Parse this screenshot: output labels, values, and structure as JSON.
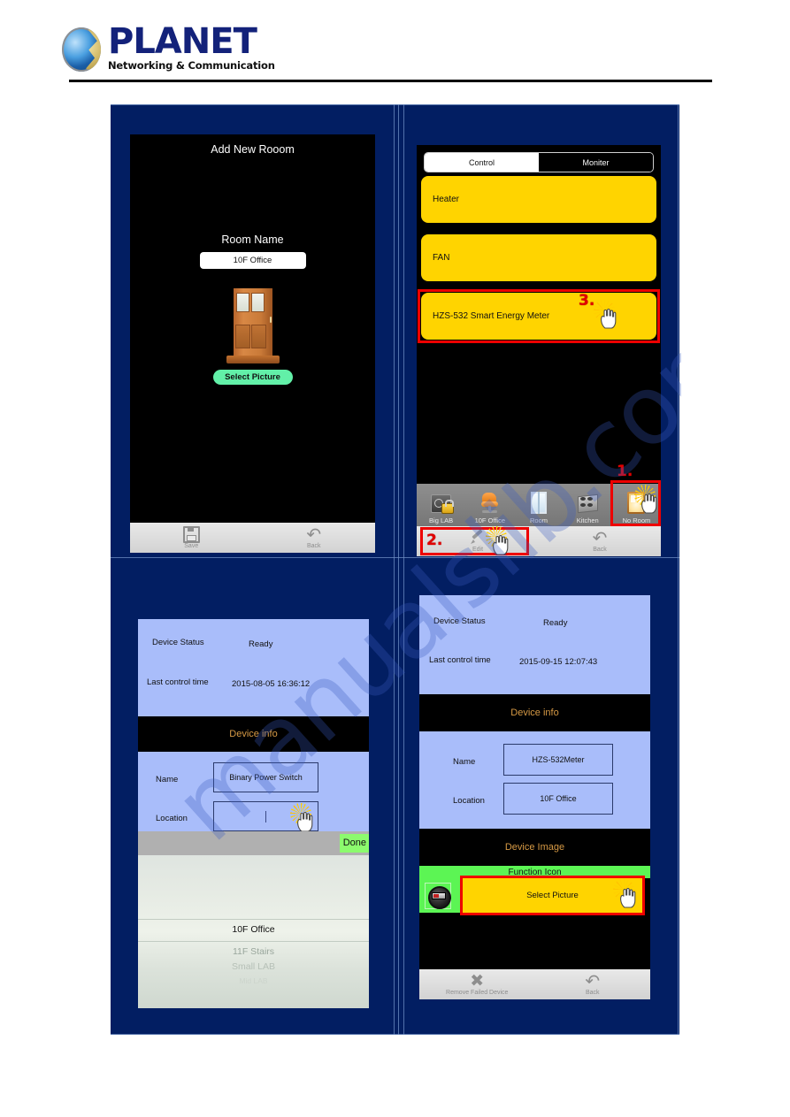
{
  "header": {
    "brand": "PLANET",
    "tagline": "Networking & Communication"
  },
  "watermark": {
    "text": "manualslib.com"
  },
  "panel1": {
    "title": "Add New Rooom",
    "room_name_label": "Room Name",
    "room_name_value": "10F Office",
    "image_icon": "wooden-door",
    "select_picture_label": "Select Picture",
    "bottom_bar": [
      {
        "icon": "save-icon",
        "label": "Save"
      },
      {
        "icon": "back-arrow-icon",
        "label": "Back"
      }
    ]
  },
  "panel2": {
    "tabs": [
      {
        "label": "Control",
        "selected": true
      },
      {
        "label": "Moniter",
        "selected": false
      }
    ],
    "devices": [
      {
        "label": "Heater"
      },
      {
        "label": "FAN"
      },
      {
        "label": "HZS-532 Smart Energy Meter"
      }
    ],
    "rooms": [
      {
        "label": "Big LAB",
        "icon": "safe-lock-icon"
      },
      {
        "label": "10F Office",
        "icon": "office-chair-icon"
      },
      {
        "label": "Room",
        "icon": "window-icon"
      },
      {
        "label": "Kitchen",
        "icon": "stove-icon"
      },
      {
        "label": "No Room",
        "icon": "lit-door-icon"
      }
    ],
    "bottom_bar": [
      {
        "icon": "pencil-icon",
        "label": "Edit"
      },
      {
        "icon": "back-arrow-icon",
        "label": "Back"
      }
    ],
    "annotations": [
      {
        "number": "1."
      },
      {
        "number": "2."
      },
      {
        "number": "3."
      }
    ]
  },
  "panel3": {
    "status_label": "Device Status",
    "status_value": "Ready",
    "last_control_label": "Last control time",
    "last_control_value": "2015-08-05 16:36:12",
    "section_header": "Device info",
    "name_label": "Name",
    "name_value": "Binary Power Switch",
    "location_label": "Location",
    "location_value": "",
    "location_placeholder": "",
    "keyboard_done_label": "Done",
    "picker_options": [
      {
        "label": "10F Office",
        "state": "selected"
      },
      {
        "label": "11F Stairs",
        "state": "dim1"
      },
      {
        "label": "Small LAB",
        "state": "dim2"
      },
      {
        "label": "Mid LAB",
        "state": "dim3"
      }
    ]
  },
  "panel4": {
    "status_label": "Device Status",
    "status_value": "Ready",
    "last_control_label": "Last control time",
    "last_control_value": "2015-09-15 12:07:43",
    "section_header": "Device info",
    "name_label": "Name",
    "name_value": "HZS-532Meter",
    "location_label": "Location",
    "location_value": "10F Office",
    "device_image_header": "Device Image",
    "function_icon_label": "Function Icon",
    "function_icon": "energy-meter-icon",
    "select_picture_label": "Select Picture",
    "bottom_bar": [
      {
        "icon": "remove-x-icon",
        "label": "Remove Failed Device"
      },
      {
        "icon": "back-arrow-icon",
        "label": "Back"
      }
    ]
  },
  "colors": {
    "page_background": "#ffffff",
    "figure_background": "#021e62",
    "device_yellow": "#ffd400",
    "annotation_red": "#ee0000",
    "device_panel_blue": "#a9bdfa",
    "section_header_orange": "#d79a45",
    "function_green": "#5cf554",
    "select_picture_green": "#62f0a8",
    "done_green": "#8cfb6e"
  }
}
